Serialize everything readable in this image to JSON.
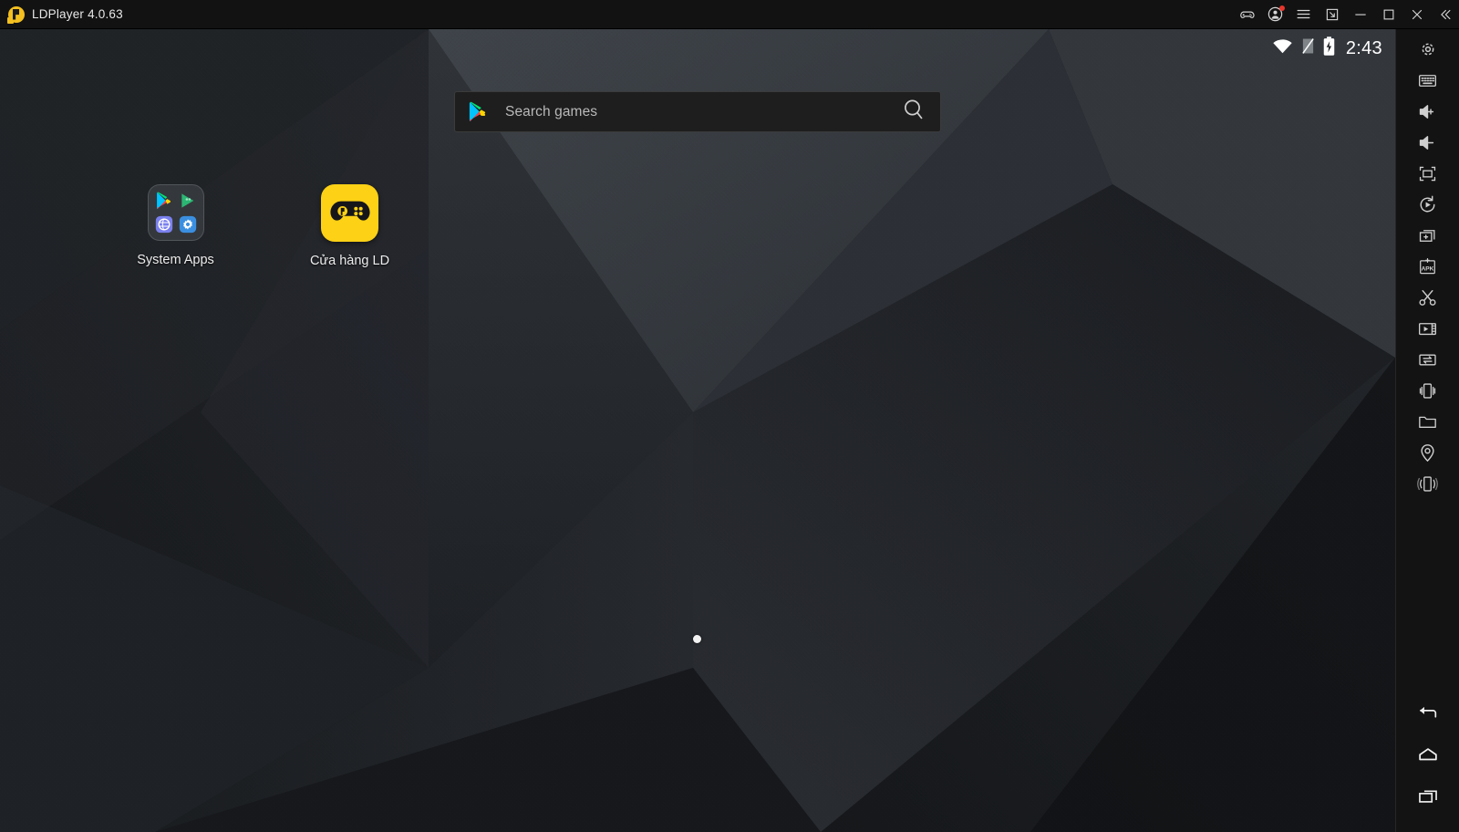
{
  "window": {
    "title": "LDPlayer 4.0.63",
    "logo_icon": "ldplayer-logo-icon",
    "controls": [
      {
        "name": "gamepad-icon",
        "label": "Keyboard mapping",
        "badge": false
      },
      {
        "name": "account-icon",
        "label": "Account",
        "badge": true
      },
      {
        "name": "hamburger-menu-icon",
        "label": "Menu",
        "badge": false
      },
      {
        "name": "resize-window-icon",
        "label": "Resize window",
        "badge": false
      },
      {
        "name": "minimize-icon",
        "label": "Minimize",
        "badge": false
      },
      {
        "name": "maximize-icon",
        "label": "Maximize",
        "badge": false
      },
      {
        "name": "close-icon",
        "label": "Close",
        "badge": false
      },
      {
        "name": "collapse-toolbar-icon",
        "label": "Collapse",
        "badge": false
      }
    ]
  },
  "statusbar": {
    "time": "2:43",
    "wifi_icon": "wifi-icon",
    "signal_icon": "no-signal-icon",
    "battery_icon": "battery-charging-icon"
  },
  "search": {
    "placeholder": "Search games",
    "play_icon": "google-play-icon",
    "search_icon": "magnifier-icon"
  },
  "homescreen": {
    "apps": [
      {
        "name": "system-apps-folder",
        "label": "System Apps",
        "type": "folder",
        "contents": [
          "play-store-icon",
          "play-games-icon",
          "browser-icon",
          "settings-icon"
        ]
      },
      {
        "name": "ld-store-app",
        "label": "Cửa hàng LD",
        "type": "app",
        "contents": [
          "ld-gamepad-icon"
        ]
      }
    ],
    "page_indicator": {
      "pages": 1,
      "current": 1
    }
  },
  "sidebar": {
    "items": [
      {
        "name": "settings-icon",
        "label": "Settings"
      },
      {
        "name": "keyboard-icon",
        "label": "Keyboard mapping"
      },
      {
        "name": "volume-up-icon",
        "label": "Volume up"
      },
      {
        "name": "volume-down-icon",
        "label": "Volume down"
      },
      {
        "name": "fullscreen-icon",
        "label": "Full screen"
      },
      {
        "name": "rotate-screen-icon",
        "label": "Rotate screen"
      },
      {
        "name": "new-instance-icon",
        "label": "Multi-instance"
      },
      {
        "name": "install-apk-icon",
        "label": "Install APK"
      },
      {
        "name": "screenshot-icon",
        "label": "Screenshot"
      },
      {
        "name": "record-video-icon",
        "label": "Record screen"
      },
      {
        "name": "file-transfer-icon",
        "label": "Shared folder transfer"
      },
      {
        "name": "shake-device-icon",
        "label": "Shake"
      },
      {
        "name": "folder-icon",
        "label": "Shared folder"
      },
      {
        "name": "location-icon",
        "label": "Virtual location"
      },
      {
        "name": "vibrate-icon",
        "label": "Vibration"
      }
    ],
    "nav": [
      {
        "name": "back-button",
        "label": "Back"
      },
      {
        "name": "home-button",
        "label": "Home"
      },
      {
        "name": "recent-apps-button",
        "label": "Recent apps"
      }
    ]
  },
  "colors": {
    "accent": "#fcd116",
    "titlebar_bg": "#121212",
    "sidebar_bg": "#131313",
    "notification_dot": "#e8362c",
    "wallpaper_light": "#3a3e43",
    "wallpaper_dark": "#131519"
  }
}
